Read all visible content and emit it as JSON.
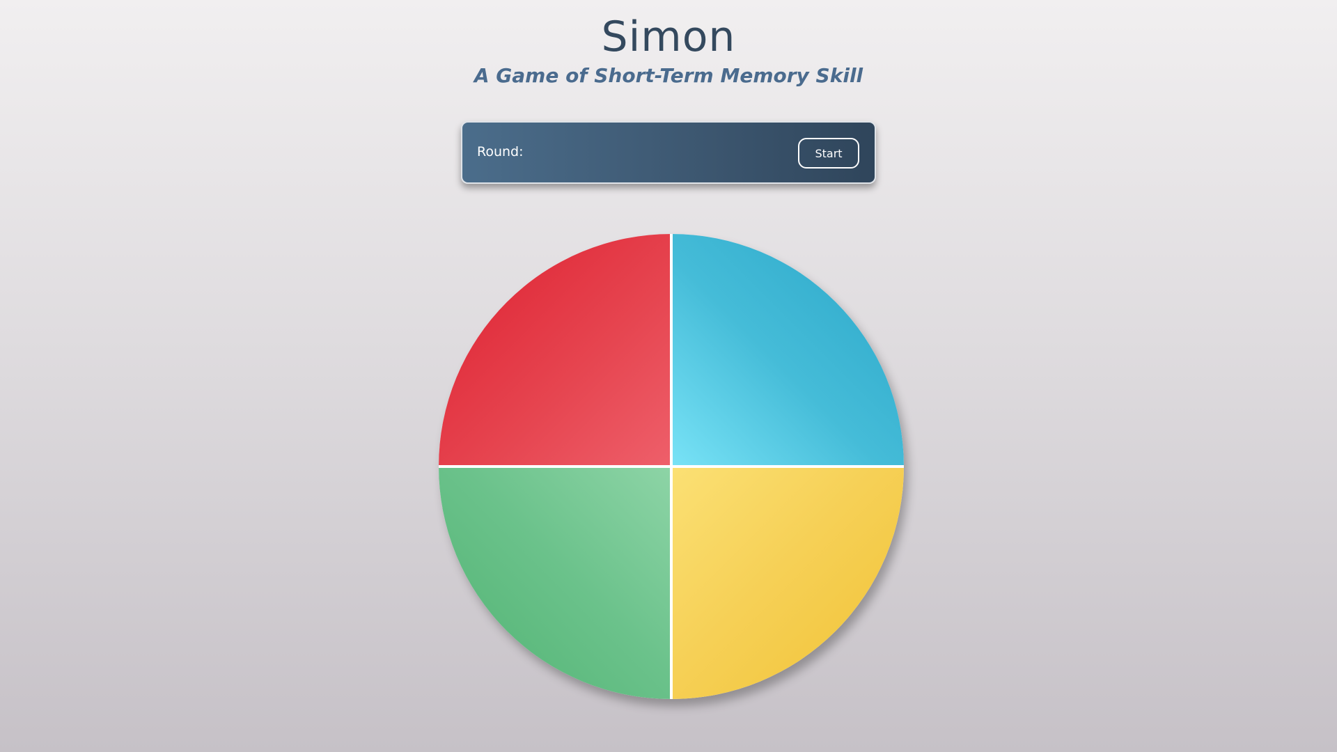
{
  "header": {
    "title": "Simon",
    "subtitle": "A Game of Short-Term Memory Skill"
  },
  "controls": {
    "round_label": "Round:",
    "round_value": "",
    "start_label": "Start"
  },
  "board": {
    "pads": [
      {
        "name": "red",
        "color": "#e53a46"
      },
      {
        "name": "blue",
        "color": "#3fb6d4"
      },
      {
        "name": "green",
        "color": "#66bd86"
      },
      {
        "name": "yellow",
        "color": "#f4cb4c"
      }
    ]
  },
  "colors": {
    "title": "#34495e",
    "subtitle": "#4a6b8e",
    "panel": "#3c566f"
  }
}
